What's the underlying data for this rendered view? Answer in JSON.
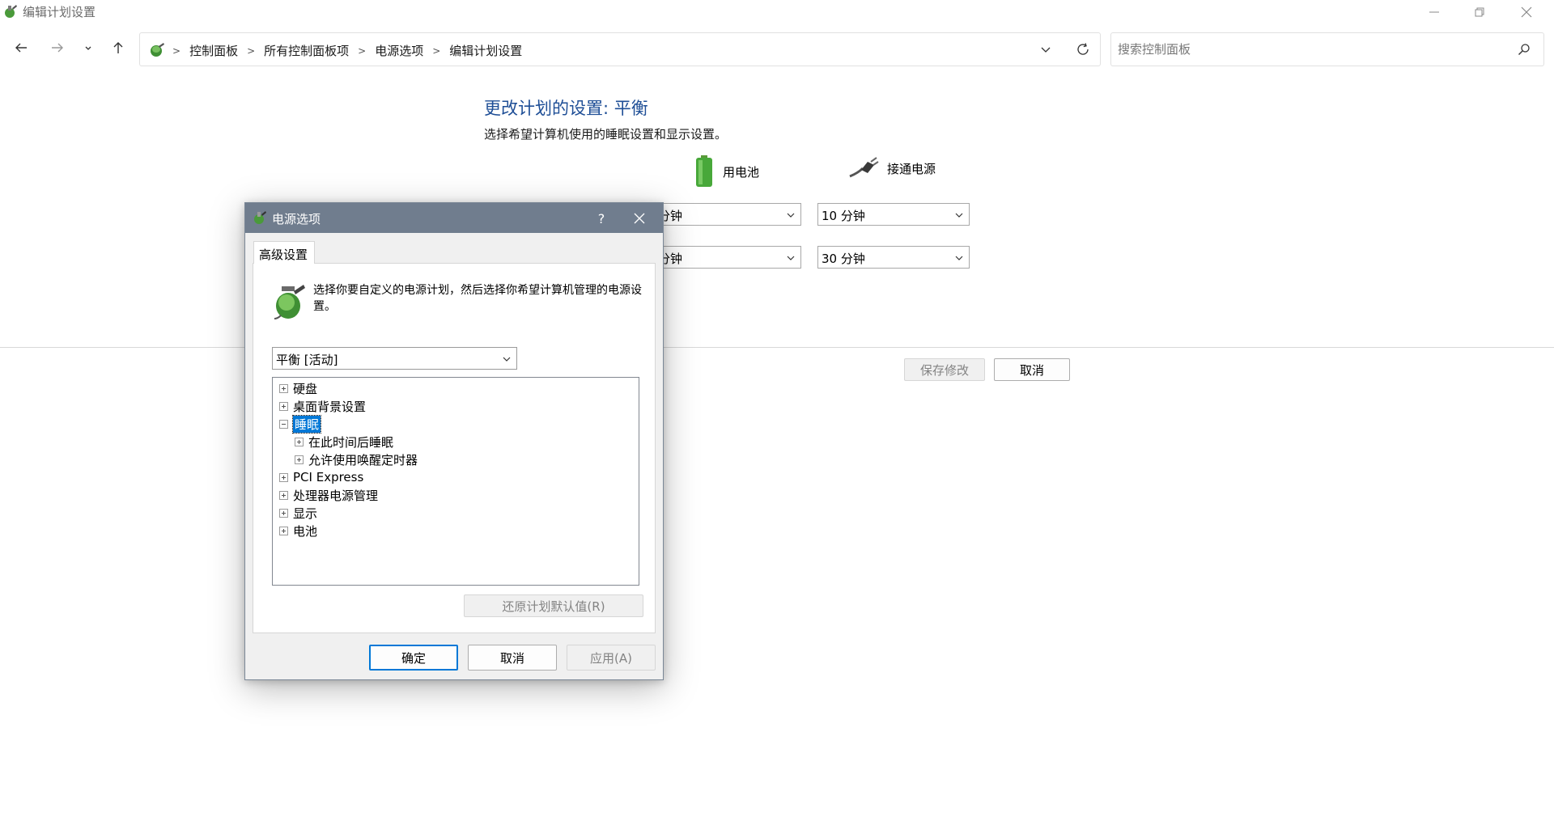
{
  "window": {
    "title": "编辑计划设置",
    "controls": [
      "minimize",
      "restore",
      "close"
    ]
  },
  "nav": {
    "breadcrumbs": [
      "控制面板",
      "所有控制面板项",
      "电源选项",
      "编辑计划设置"
    ],
    "search": {
      "placeholder": "搜索控制面板",
      "value": ""
    }
  },
  "page": {
    "heading": "更改计划的设置: 平衡",
    "subtitle": "选择希望计算机使用的睡眠设置和显示设置。",
    "columns": {
      "battery": "用电池",
      "plugged": "接通电源"
    },
    "rows": [
      {
        "battery": "分钟",
        "plugged": "10 分钟"
      },
      {
        "battery": "分钟",
        "plugged": "30 分钟"
      }
    ],
    "save_label": "保存修改",
    "cancel_label": "取消"
  },
  "dialog": {
    "title": "电源选项",
    "help": "?",
    "tab": "高级设置",
    "description": "选择你要自定义的电源计划，然后选择你希望计算机管理的电源设置。",
    "plan": "平衡 [活动]",
    "tree": [
      {
        "label": "硬盘",
        "level": 0,
        "expanded": false,
        "selected": false
      },
      {
        "label": "桌面背景设置",
        "level": 0,
        "expanded": false,
        "selected": false
      },
      {
        "label": "睡眠",
        "level": 0,
        "expanded": true,
        "selected": true
      },
      {
        "label": "在此时间后睡眠",
        "level": 1,
        "expanded": false,
        "selected": false
      },
      {
        "label": "允许使用唤醒定时器",
        "level": 1,
        "expanded": false,
        "selected": false
      },
      {
        "label": "PCI Express",
        "level": 0,
        "expanded": false,
        "selected": false
      },
      {
        "label": "处理器电源管理",
        "level": 0,
        "expanded": false,
        "selected": false
      },
      {
        "label": "显示",
        "level": 0,
        "expanded": false,
        "selected": false
      },
      {
        "label": "电池",
        "level": 0,
        "expanded": false,
        "selected": false
      }
    ],
    "restore_label": "还原计划默认值(R)",
    "ok_label": "确定",
    "cancel_label": "取消",
    "apply_label": "应用(A)"
  },
  "colors": {
    "heading_blue": "#1e4e96",
    "dialog_titlebar": "#707d8e",
    "selection": "#0078d7"
  }
}
